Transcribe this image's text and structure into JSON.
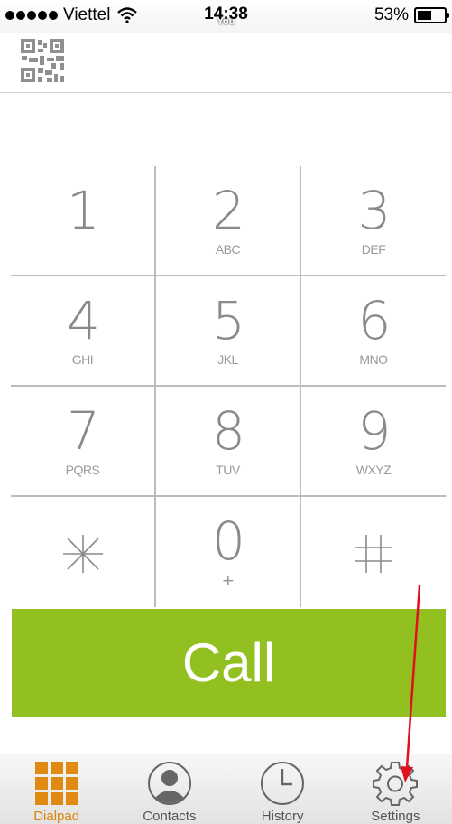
{
  "status_bar": {
    "carrier": "Viettel",
    "time": "14:38",
    "sub_label": "You",
    "battery": "53%",
    "battery_level": 0.53,
    "icons": [
      "signal-dots-icon",
      "wifi-icon",
      "battery-icon"
    ]
  },
  "header": {
    "qr_icon": "qr-code-icon",
    "number_value": ""
  },
  "keypad": {
    "keys": [
      {
        "digit": "1",
        "letters": ""
      },
      {
        "digit": "2",
        "letters": "ABC"
      },
      {
        "digit": "3",
        "letters": "DEF"
      },
      {
        "digit": "4",
        "letters": "GHI"
      },
      {
        "digit": "5",
        "letters": "JKL"
      },
      {
        "digit": "6",
        "letters": "MNO"
      },
      {
        "digit": "7",
        "letters": "PQRS"
      },
      {
        "digit": "8",
        "letters": "TUV"
      },
      {
        "digit": "9",
        "letters": "WXYZ"
      },
      {
        "digit": "*",
        "letters": "",
        "icon": "asterisk-icon"
      },
      {
        "digit": "0",
        "letters": "+"
      },
      {
        "digit": "#",
        "letters": "",
        "icon": "hash-icon"
      }
    ]
  },
  "call_button": {
    "label": "Call",
    "color": "#92c021"
  },
  "tab_bar": {
    "active_color": "#d98409",
    "tabs": [
      {
        "label": "Dialpad",
        "icon": "dialpad-grid-icon",
        "active": true
      },
      {
        "label": "Contacts",
        "icon": "contact-person-icon",
        "active": false
      },
      {
        "label": "History",
        "icon": "clock-icon",
        "active": false
      },
      {
        "label": "Settings",
        "icon": "gear-icon",
        "active": false
      }
    ]
  },
  "annotation": {
    "icon": "red-arrow-annotation",
    "color": "#e01020"
  }
}
